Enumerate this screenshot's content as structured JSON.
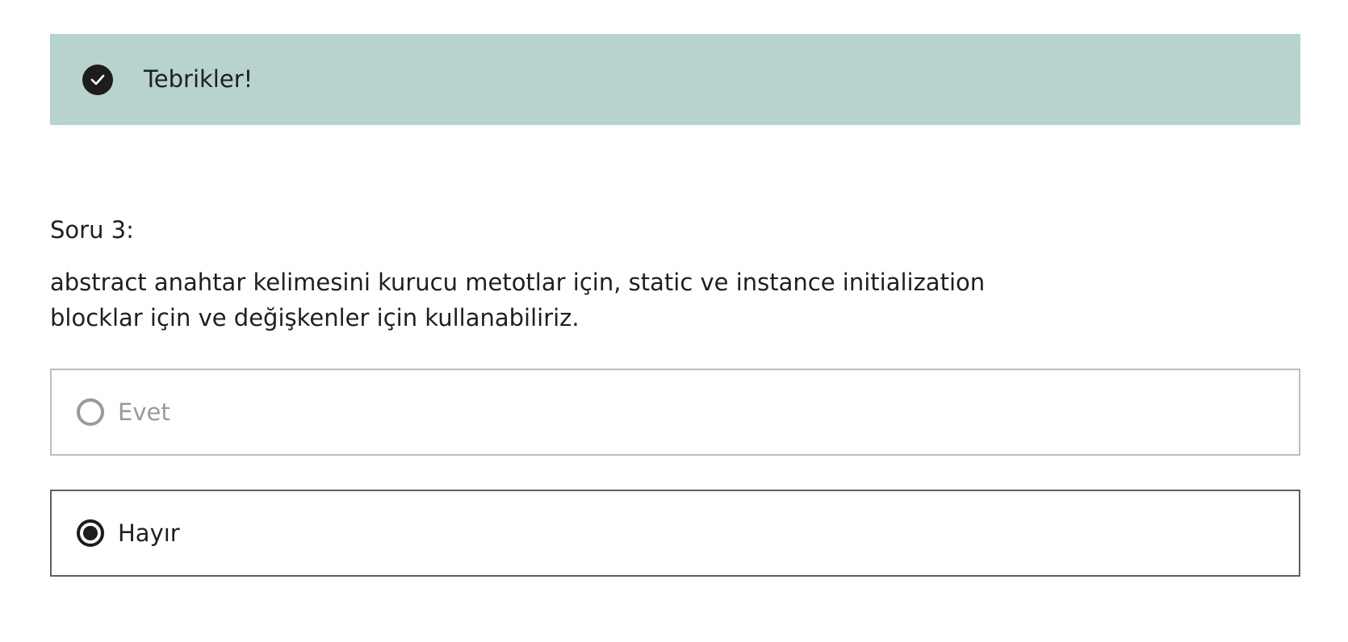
{
  "feedback": {
    "icon": "check-circle-icon",
    "message": "Tebrikler!",
    "background_color": "#b6d3ce"
  },
  "question": {
    "number_label": "Soru 3:",
    "text": "abstract anahtar kelimesini kurucu metotlar için, static ve instance initialization blocklar için ve değişkenler için kullanabiliriz."
  },
  "options": [
    {
      "label": "Evet",
      "selected": false
    },
    {
      "label": "Hayır",
      "selected": true
    }
  ]
}
